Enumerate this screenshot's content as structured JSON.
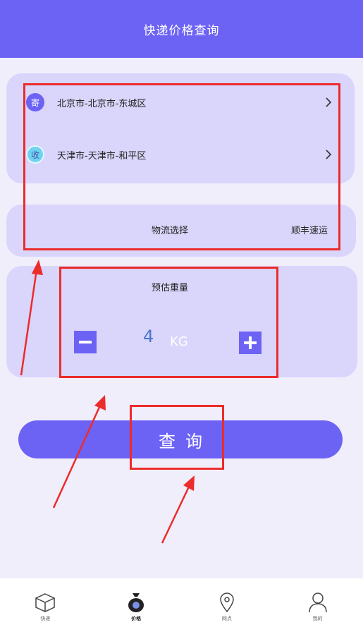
{
  "header": {
    "title": "快递价格查询"
  },
  "address": {
    "sender": {
      "badge": "寄",
      "text": "北京市-北京市-东城区",
      "icon": "chevron-right-icon"
    },
    "receiver": {
      "badge": "收",
      "text": "天津市-天津市-和平区",
      "icon": "chevron-right-icon"
    }
  },
  "logistics": {
    "label": "物流选择",
    "value": "顺丰速运"
  },
  "weight": {
    "title": "预估重量",
    "value": "4",
    "unit": "KG",
    "minus_icon": "minus-icon",
    "plus_icon": "plus-icon"
  },
  "query_button": {
    "label": "查询"
  },
  "tabbar": {
    "items": [
      {
        "label": "快递",
        "icon": "package-icon"
      },
      {
        "label": "价格",
        "icon": "money-bag-icon",
        "active": true
      },
      {
        "label": "网点",
        "icon": "location-pin-icon"
      },
      {
        "label": "我的",
        "icon": "user-icon"
      }
    ]
  },
  "colors": {
    "primary": "#6c63f5",
    "card": "#d9d5fb",
    "background": "#f1eefc",
    "annotation": "#ec2b2b"
  }
}
